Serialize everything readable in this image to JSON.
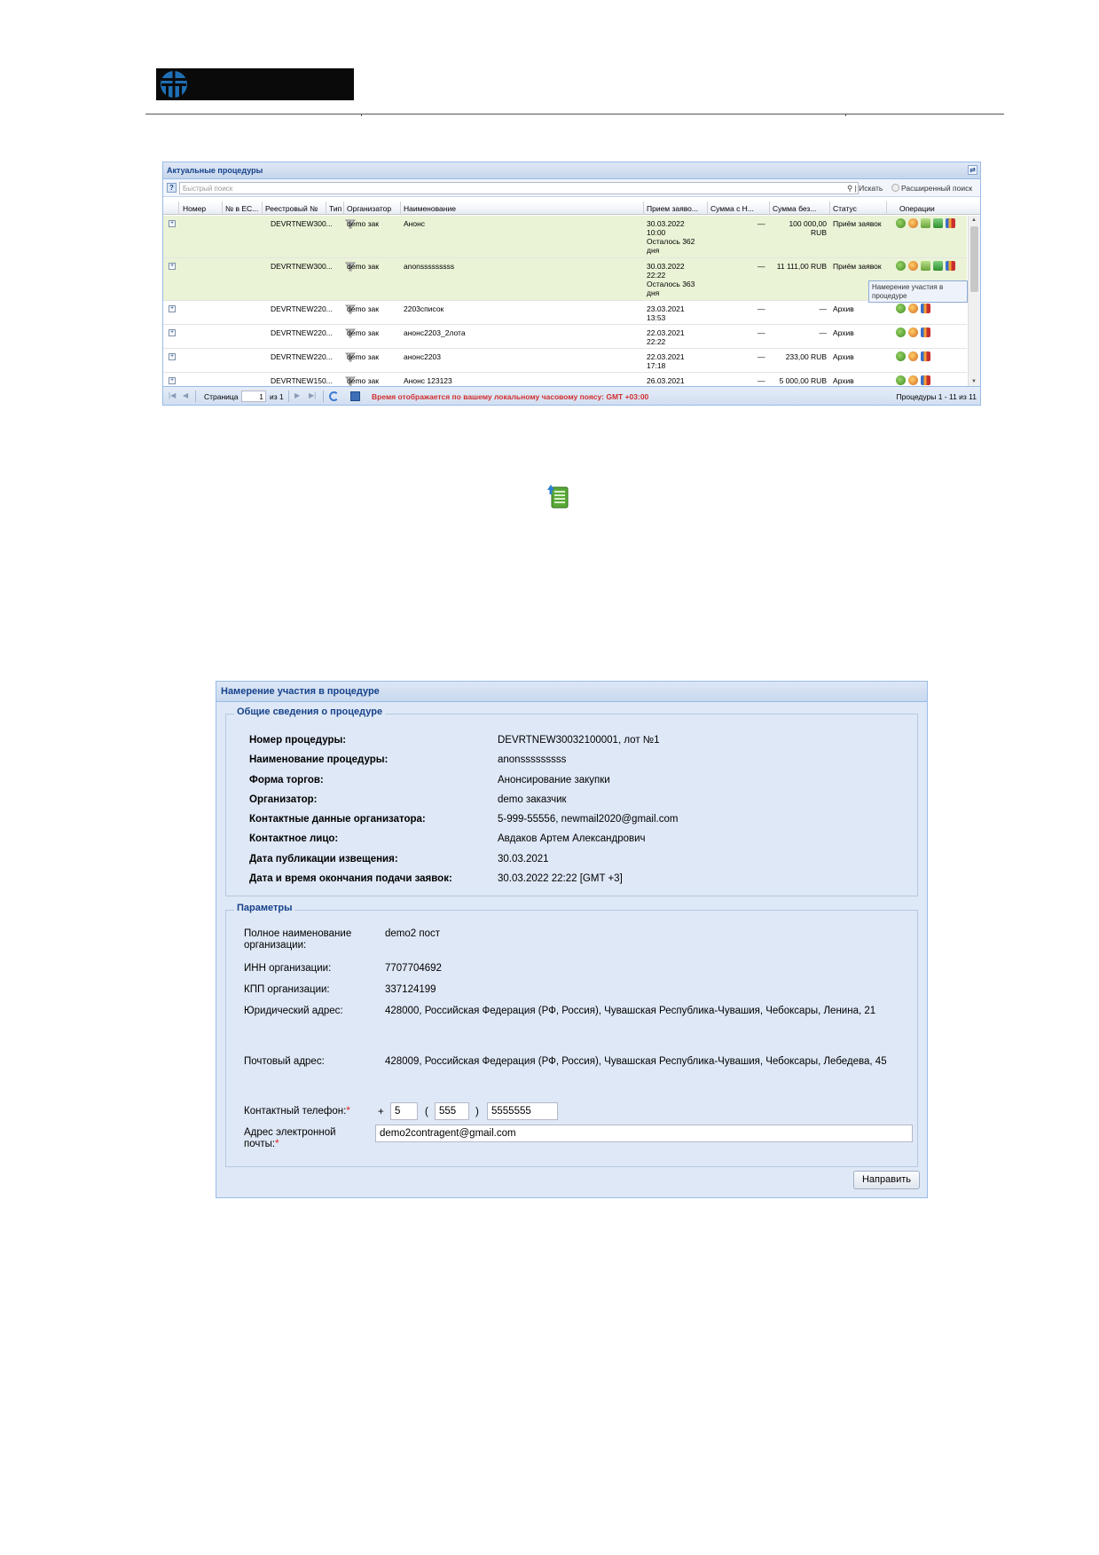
{
  "grid": {
    "title": "Актуальные процедуры",
    "search_placeholder": "Быстрый поиск",
    "search_button": "Искать",
    "advanced_search": "Расширенный поиск",
    "columns": [
      "Номер",
      "№ в ЕС...",
      "Реестровый №",
      "Тип",
      "Организатор",
      "Наименование",
      "Прием заяво...",
      "Сумма с Н...",
      "Сумма без...",
      "Статус",
      "Операции"
    ],
    "rows": [
      {
        "reg": "DEVRTNEW300...",
        "org": "demo зак",
        "name": "Анонс",
        "date": [
          "30.03.2022",
          "10:00",
          "Осталось 362",
          "дня"
        ],
        "sum_vat": "—",
        "sum": [
          "100 000,00",
          "RUB"
        ],
        "status": "Приём заявок",
        "highlight": true
      },
      {
        "reg": "DEVRTNEW300...",
        "org": "demo зак",
        "name": "anonsssssssss",
        "date": [
          "30.03.2022",
          "22:22",
          "Осталось 363",
          "дня"
        ],
        "sum_vat": "—",
        "sum": [
          "11 111,00 RUB"
        ],
        "status": "Приём заявок",
        "highlight": true
      },
      {
        "reg": "DEVRTNEW220...",
        "org": "demo зак",
        "name": "2203список",
        "date": [
          "23.03.2021",
          "13:53"
        ],
        "sum_vat": "—",
        "sum": [
          "—"
        ],
        "status": "Архив",
        "highlight": false
      },
      {
        "reg": "DEVRTNEW220...",
        "org": "demo зак",
        "name": "анонс2203_2лота",
        "date": [
          "22.03.2021",
          "22:22"
        ],
        "sum_vat": "—",
        "sum": [
          "—"
        ],
        "status": "Архив",
        "highlight": false
      },
      {
        "reg": "DEVRTNEW220...",
        "org": "demo зак",
        "name": "анонс2203",
        "date": [
          "22.03.2021",
          "17:18"
        ],
        "sum_vat": "—",
        "sum": [
          "233,00 RUB"
        ],
        "status": "Архив",
        "highlight": false
      },
      {
        "reg": "DEVRTNEW150...",
        "org": "demo зак",
        "name": "Анонс 123123",
        "date": [
          "26.03.2021"
        ],
        "sum_vat": "—",
        "sum": [
          "5 000,00 RUB"
        ],
        "status": "Архив",
        "highlight": false
      }
    ],
    "tooltip": [
      "Намерение участия в",
      "процедуре"
    ],
    "pager": {
      "page_label": "Страница",
      "page_value": "1",
      "of_label": "из 1",
      "timezone_note": "Время отображается по вашему локальному часовому поясу: GMT +03:00",
      "summary": "Процедуры 1 - 11 из 11"
    }
  },
  "form": {
    "title": "Намерение участия в процедуре",
    "info_legend": "Общие сведения о процедуре",
    "info": [
      {
        "label": "Номер процедуры:",
        "value": "DEVRTNEW30032100001, лот №1"
      },
      {
        "label": "Наименование процедуры:",
        "value": "anonsssssssss"
      },
      {
        "label": "Форма торгов:",
        "value": "Анонсирование закупки"
      },
      {
        "label": "Организатор:",
        "value": "demo заказчик"
      },
      {
        "label": "Контактные данные организатора:",
        "value": "5-999-55556, newmail2020@gmail.com"
      },
      {
        "label": "Контактное лицо:",
        "value": "Авдаков Артем Александрович"
      },
      {
        "label": "Дата публикации извещения:",
        "value": "30.03.2021"
      },
      {
        "label": "Дата и время окончания подачи заявок:",
        "value": "30.03.2022 22:22 [GMT +3]"
      }
    ],
    "params_legend": "Параметры",
    "params": {
      "full_name_label_1": "Полное наименование",
      "full_name_label_2": "организации:",
      "full_name": "demo2 пост",
      "inn_label": "ИНН организации:",
      "inn": "7707704692",
      "kpp_label": "КПП организации:",
      "kpp": "337124199",
      "legal_address_label": "Юридический адрес:",
      "legal_address": "428000, Российская Федерация (РФ, Россия), Чувашская Республика-Чувашия, Чебоксары, Ленина, 21",
      "postal_address_label": "Почтовый адрес:",
      "postal_address": "428009, Российская Федерация (РФ, Россия), Чувашская Республика-Чувашия, Чебоксары, Лебедева, 45",
      "phone_label": "Контактный телефон:",
      "phone_country": "5",
      "phone_code": "555",
      "phone_number": "5555555",
      "email_label_1": "Адрес электронной",
      "email_label_2": "почты:",
      "email": "demo2contragent@gmail.com",
      "required_mark": "*",
      "plus": "+",
      "paren_open": "(",
      "paren_close": ")"
    },
    "submit_button": "Направить"
  }
}
